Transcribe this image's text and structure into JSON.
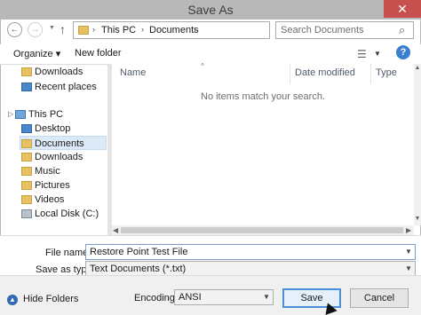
{
  "window": {
    "title": "Save As",
    "close_glyph": "✕"
  },
  "nav": {
    "back_glyph": "←",
    "forward_glyph": "→",
    "recent_glyph": "▼",
    "up_glyph": "↑"
  },
  "address": {
    "segments": [
      "This PC",
      "Documents"
    ],
    "separator": "›",
    "dropdown_glyph": "▼",
    "refresh_glyph": "↻"
  },
  "search": {
    "placeholder": "Search Documents",
    "icon_glyph": "⌕"
  },
  "toolbar": {
    "organize_label": "Organize ▾",
    "new_folder_label": "New folder",
    "views_glyph": "☰",
    "views_dropdown_glyph": "▼",
    "help_label": "?"
  },
  "sidebar": {
    "items": [
      {
        "label": "Downloads",
        "icon": "downloads-icon"
      },
      {
        "label": "Recent places",
        "icon": "recent-places-icon"
      },
      {
        "label": "This PC",
        "icon": "this-pc-icon"
      },
      {
        "label": "Desktop",
        "icon": "desktop-icon"
      },
      {
        "label": "Documents",
        "icon": "documents-icon"
      },
      {
        "label": "Downloads",
        "icon": "downloads-icon"
      },
      {
        "label": "Music",
        "icon": "music-icon"
      },
      {
        "label": "Pictures",
        "icon": "pictures-icon"
      },
      {
        "label": "Videos",
        "icon": "videos-icon"
      },
      {
        "label": "Local Disk (C:)",
        "icon": "local-disk-icon"
      }
    ],
    "selected_index": 4,
    "expand_glyph": "▷"
  },
  "file_list": {
    "columns": [
      "Name",
      "Date modified",
      "Type"
    ],
    "sort_glyph": "^",
    "empty_message": "No items match your search."
  },
  "scroll": {
    "up_glyph": "▲",
    "down_glyph": "▼",
    "left_glyph": "◀",
    "right_glyph": "▶"
  },
  "form": {
    "file_name_label": "File name:",
    "file_name_value": "Restore Point Test File",
    "save_as_type_label": "Save as type:",
    "save_as_type_value": "Text Documents (*.txt)",
    "encoding_label": "Encoding:",
    "encoding_value": "ANSI",
    "dropdown_glyph": "▼"
  },
  "footer": {
    "hide_folders_label": "Hide Folders",
    "hide_folders_glyph": "▲",
    "save_label": "Save",
    "cancel_label": "Cancel"
  },
  "colors": {
    "titlebar": "#b8b8b8",
    "close": "#c7504f",
    "accent": "#4a90d9",
    "selection": "#dceaf7"
  }
}
